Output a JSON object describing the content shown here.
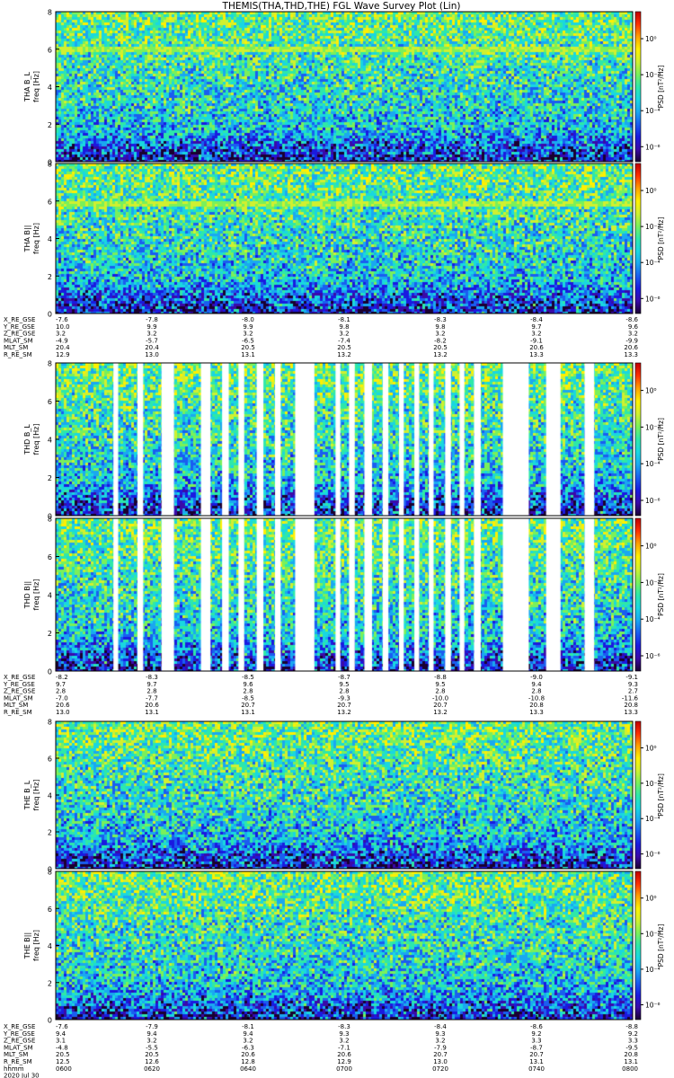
{
  "title": "THEMIS(THA,THD,THE) FGL Wave Survey Plot (Lin)",
  "colors": {
    "cmap": [
      "#1a0030",
      "#3a0aa8",
      "#1a1ae0",
      "#1a5ef0",
      "#1aa8f0",
      "#19d7e0",
      "#2ee8a8",
      "#7af05a",
      "#d0f030",
      "#fff000",
      "#ffa000",
      "#ff3000",
      "#c00000"
    ],
    "line_color": "#2be9a0",
    "gap_color": "#ffffff"
  },
  "colorbar": {
    "label": "PSD [nT²/Hz]",
    "ticks": [
      "10⁰",
      "10⁻²",
      "10⁻⁴",
      "10⁻⁶"
    ]
  },
  "chart_data": [
    {
      "type": "heatmap",
      "probe": "tha",
      "panels": [
        {
          "ylabel": "THA B_L",
          "yunit": "freq [Hz]",
          "ylim": [
            0,
            8
          ],
          "yticks": [
            "0",
            "2",
            "4",
            "6",
            "8"
          ],
          "line_freq": 6.0
        },
        {
          "ylabel": "THA B||",
          "yunit": "freq [Hz]",
          "ylim": [
            0,
            8
          ],
          "yticks": [
            "0",
            "2",
            "4",
            "6",
            "8"
          ],
          "line_freq": 5.8
        }
      ],
      "gaps": [],
      "ephemeris": [
        {
          "label": "X_RE_GSE",
          "values": [
            "-7.6",
            "-7.8",
            "-8.0",
            "-8.1",
            "-8.3",
            "-8.4",
            "-8.6"
          ]
        },
        {
          "label": "Y_RE_GSE",
          "values": [
            "10.0",
            "9.9",
            "9.9",
            "9.8",
            "9.8",
            "9.7",
            "9.6"
          ]
        },
        {
          "label": "Z_RE_GSE",
          "values": [
            "3.2",
            "3.2",
            "3.2",
            "3.2",
            "3.2",
            "3.2",
            "3.2"
          ]
        },
        {
          "label": "MLAT_SM",
          "values": [
            "-4.9",
            "-5.7",
            "-6.5",
            "-7.4",
            "-8.2",
            "-9.1",
            "-9.9"
          ]
        },
        {
          "label": "MLT_SM",
          "values": [
            "20.4",
            "20.4",
            "20.5",
            "20.5",
            "20.5",
            "20.6",
            "20.6"
          ]
        },
        {
          "label": "R_RE_SM",
          "values": [
            "12.9",
            "13.0",
            "13.1",
            "13.2",
            "13.2",
            "13.3",
            "13.3"
          ]
        }
      ]
    },
    {
      "type": "heatmap",
      "probe": "thd",
      "panels": [
        {
          "ylabel": "THD B_L",
          "yunit": "freq [Hz]",
          "ylim": [
            0,
            8
          ],
          "yticks": [
            "0",
            "2",
            "4",
            "6",
            "8"
          ],
          "line_freq": null
        },
        {
          "ylabel": "THD B||",
          "yunit": "freq [Hz]",
          "ylim": [
            0,
            8
          ],
          "yticks": [
            "0",
            "2",
            "4",
            "6",
            "8"
          ],
          "line_freq": null
        }
      ],
      "gaps": [
        [
          6.0,
          6.5
        ],
        [
          8.5,
          9.1
        ],
        [
          11.0,
          12.3
        ],
        [
          15.1,
          16.1
        ],
        [
          17.3,
          18.0
        ],
        [
          19.0,
          19.6
        ],
        [
          20.9,
          21.6
        ],
        [
          22.8,
          23.4
        ],
        [
          24.9,
          26.9
        ],
        [
          29.1,
          29.6
        ],
        [
          30.5,
          31.1
        ],
        [
          32.1,
          32.9
        ],
        [
          34.0,
          34.6
        ],
        [
          35.7,
          36.2
        ],
        [
          37.3,
          37.8
        ],
        [
          38.8,
          39.3
        ],
        [
          40.5,
          41.1
        ],
        [
          42.0,
          42.5
        ],
        [
          43.5,
          44.2
        ],
        [
          46.5,
          49.2
        ],
        [
          51.0,
          52.5
        ],
        [
          55.0,
          56.0
        ]
      ],
      "ephemeris": [
        {
          "label": "X_RE_GSE",
          "values": [
            "-8.2",
            "-8.3",
            "-8.5",
            "-8.7",
            "-8.8",
            "-9.0",
            "-9.1"
          ]
        },
        {
          "label": "Y_RE_GSE",
          "values": [
            "9.7",
            "9.7",
            "9.6",
            "9.5",
            "9.5",
            "9.4",
            "9.3"
          ]
        },
        {
          "label": "Z_RE_GSE",
          "values": [
            "2.8",
            "2.8",
            "2.8",
            "2.8",
            "2.8",
            "2.8",
            "2.7"
          ]
        },
        {
          "label": "MLAT_SM",
          "values": [
            "-7.0",
            "-7.7",
            "-8.5",
            "-9.3",
            "-10.0",
            "-10.8",
            "-11.6"
          ]
        },
        {
          "label": "MLT_SM",
          "values": [
            "20.6",
            "20.6",
            "20.7",
            "20.7",
            "20.7",
            "20.8",
            "20.8"
          ]
        },
        {
          "label": "R_RE_SM",
          "values": [
            "13.0",
            "13.1",
            "13.1",
            "13.2",
            "13.2",
            "13.3",
            "13.3"
          ]
        }
      ]
    },
    {
      "type": "heatmap",
      "probe": "the",
      "panels": [
        {
          "ylabel": "THE B_L",
          "yunit": "freq [Hz]",
          "ylim": [
            0,
            8
          ],
          "yticks": [
            "0",
            "2",
            "4",
            "6",
            "8"
          ],
          "line_freq": null
        },
        {
          "ylabel": "THE B||",
          "yunit": "freq [Hz]",
          "ylim": [
            0,
            8
          ],
          "yticks": [
            "0",
            "2",
            "4",
            "6",
            "8"
          ],
          "line_freq": null
        }
      ],
      "gaps": [],
      "ephemeris": [
        {
          "label": "X_RE_GSE",
          "values": [
            "-7.6",
            "-7.9",
            "-8.1",
            "-8.3",
            "-8.4",
            "-8.6",
            "-8.8"
          ]
        },
        {
          "label": "Y_RE_GSE",
          "values": [
            "9.4",
            "9.4",
            "9.4",
            "9.3",
            "9.3",
            "9.2",
            "9.2"
          ]
        },
        {
          "label": "Z_RE_GSE",
          "values": [
            "3.1",
            "3.2",
            "3.2",
            "3.2",
            "3.2",
            "3.3",
            "3.3"
          ]
        },
        {
          "label": "MLAT_SM",
          "values": [
            "-4.8",
            "-5.5",
            "-6.3",
            "-7.1",
            "-7.9",
            "-8.7",
            "-9.5"
          ]
        },
        {
          "label": "MLT_SM",
          "values": [
            "20.5",
            "20.5",
            "20.6",
            "20.6",
            "20.7",
            "20.7",
            "20.8"
          ]
        },
        {
          "label": "R_RE_SM",
          "values": [
            "12.5",
            "12.6",
            "12.8",
            "12.9",
            "13.0",
            "13.1",
            "13.1"
          ]
        }
      ],
      "time_label": "hhmm",
      "time_ticks": [
        "0600",
        "0620",
        "0640",
        "0700",
        "0720",
        "0740",
        "0800"
      ],
      "date": "2020 Jul 30"
    }
  ]
}
